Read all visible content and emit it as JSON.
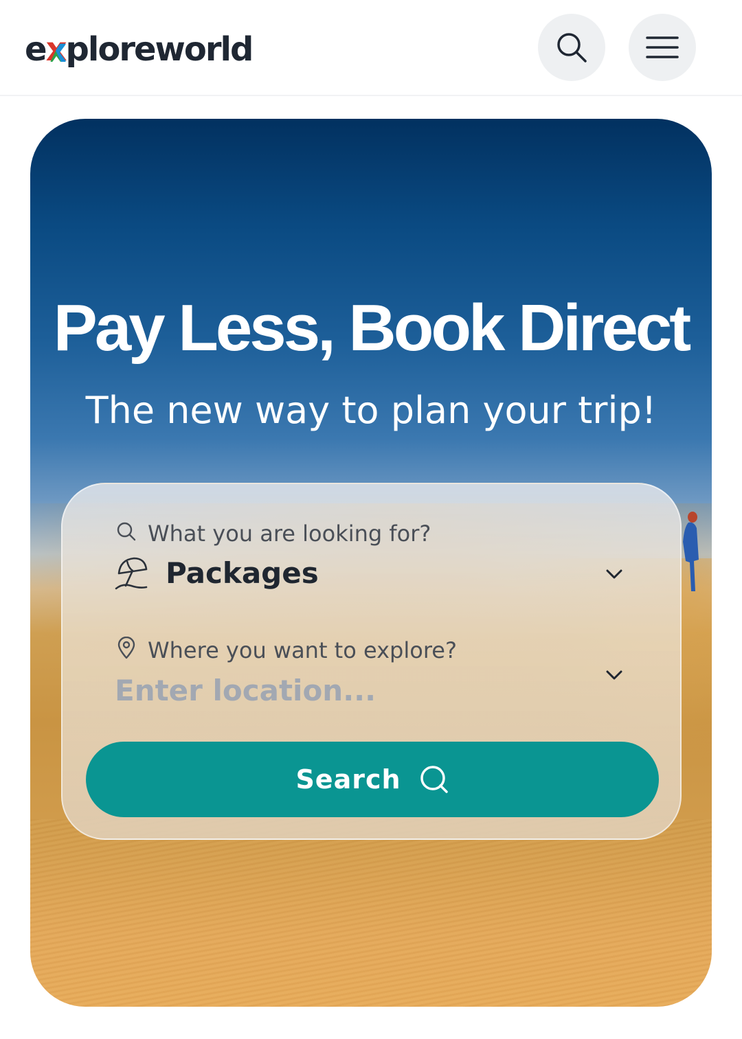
{
  "header": {
    "logo": {
      "pre": "e",
      "x": "x",
      "post": "ploreworld"
    },
    "search_icon": "search-icon",
    "menu_icon": "menu-icon"
  },
  "hero": {
    "headline": "Pay Less, Book Direct",
    "subheadline": "The new way to plan your trip!"
  },
  "search_card": {
    "type_label": "What you are looking for?",
    "type_value": "Packages",
    "type_icon": "beach-umbrella-icon",
    "location_label": "Where you want to explore?",
    "location_placeholder": "Enter location...",
    "location_value": "",
    "location_icon": "map-pin-icon",
    "button_label": "Search"
  },
  "colors": {
    "accent": "#0a9592",
    "text_dark": "#1f2630",
    "placeholder": "#a2a8b2",
    "header_button_bg": "#eef0f2"
  }
}
